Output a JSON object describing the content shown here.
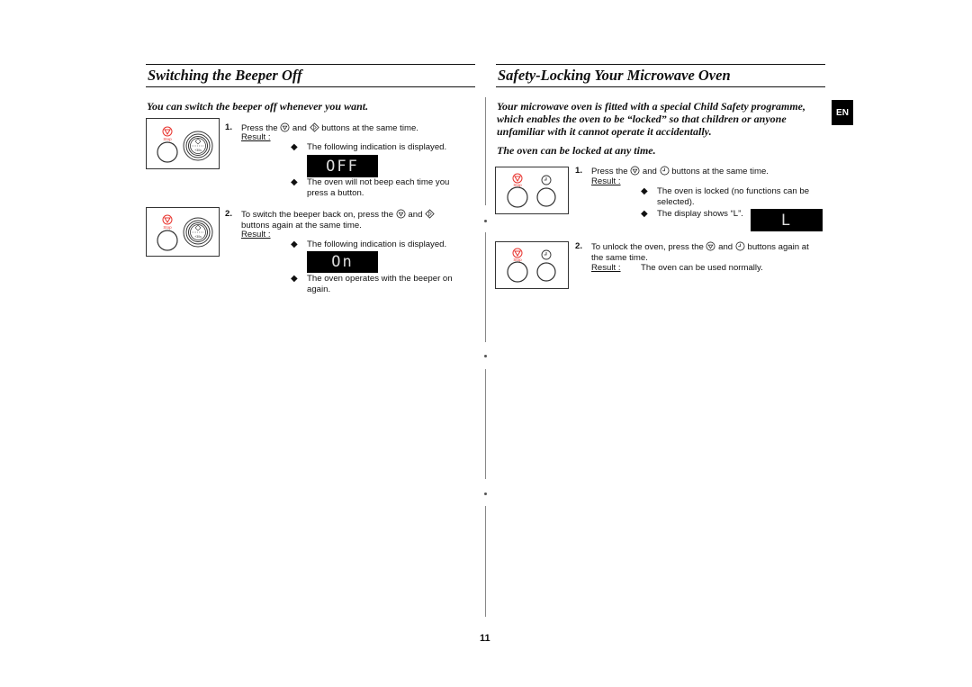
{
  "page_number": "11",
  "language_tab": "EN",
  "left": {
    "title": "Switching the Beeper Off",
    "intro": "You can switch the beeper off whenever you want.",
    "step1": {
      "num": "1.",
      "pre": "Press the",
      "mid": "and",
      "post": "buttons at the same time.",
      "result_label": "Result :",
      "bullet1": "The following indication is displayed.",
      "display": "OFF",
      "bullet2_l1": "The oven will not beep each time you",
      "bullet2_l2": "press a button."
    },
    "step2": {
      "num": "2.",
      "pre": "To switch the beeper back on, press the",
      "mid": "and",
      "line2": "buttons again at the same time.",
      "result_label": "Result :",
      "bullet1": "The following indication is displayed.",
      "display": "On",
      "bullet2_l1": "The oven operates with the beeper on",
      "bullet2_l2": "again."
    },
    "panel": {
      "stop_label": "Stop",
      "dial_label": "+30s"
    }
  },
  "right": {
    "title": "Safety-Locking Your Microwave Oven",
    "intro_l1": "Your microwave oven is fitted with a special Child Safety programme,",
    "intro_l2": "which enables the oven to be “locked” so that children or anyone",
    "intro_l3": "unfamiliar with it cannot operate it accidentally.",
    "intro2": "The oven can be locked at any time.",
    "step1": {
      "num": "1.",
      "pre": "Press the",
      "mid": "and",
      "post": "buttons at the same time.",
      "result_label": "Result :",
      "bullet1_l1": "The oven is locked (no functions can be",
      "bullet1_l2": "selected).",
      "bullet2": "The display shows “L”.",
      "display": "L"
    },
    "step2": {
      "num": "2.",
      "pre": "To unlock the oven, press the",
      "mid": "and",
      "post": "buttons again at",
      "line2": "the same time.",
      "result_label": "Result :",
      "result_text": "The oven can be used normally."
    },
    "panel": {
      "stop_label": "Stop"
    }
  },
  "colors": {
    "stop_red": "#e8352f",
    "text": "#111111",
    "divider": "#888888"
  }
}
